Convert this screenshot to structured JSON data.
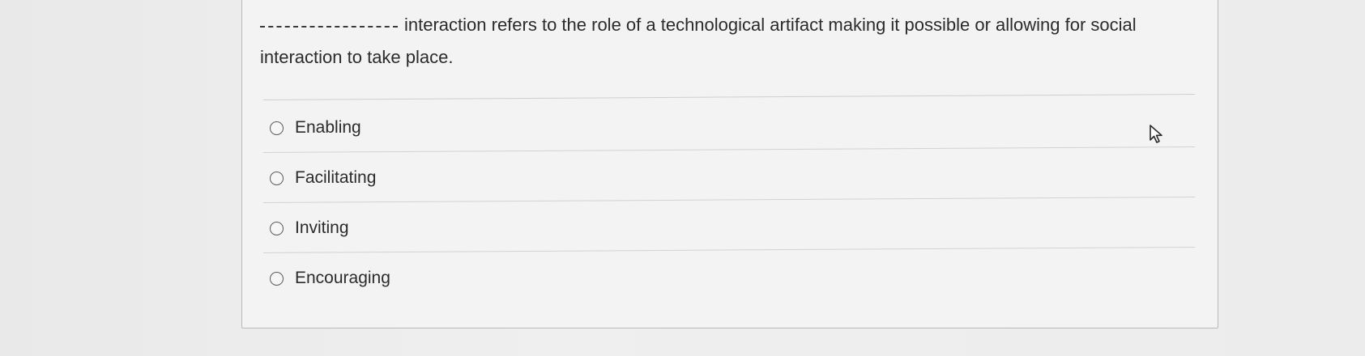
{
  "question": {
    "blank_marker": "",
    "text": "interaction refers to the role of a technological artifact making it possible or allowing for social interaction to take place."
  },
  "options": [
    {
      "label": "Enabling",
      "selected": false
    },
    {
      "label": "Facilitating",
      "selected": false
    },
    {
      "label": "Inviting",
      "selected": false
    },
    {
      "label": "Encouraging",
      "selected": false
    }
  ],
  "cursor": {
    "icon": "arrow-pointer-icon"
  }
}
